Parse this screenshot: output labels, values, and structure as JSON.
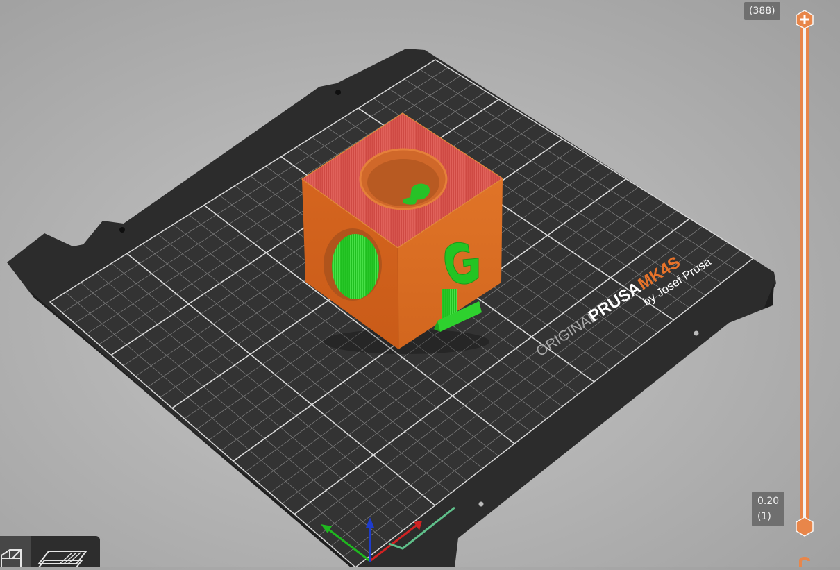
{
  "bed": {
    "brand_prefix": "ORIGINAL",
    "brand_name": "PRUSA",
    "model": "MK4S",
    "tagline": "by Josef Prusa"
  },
  "layer_slider": {
    "top_value": "(388)",
    "bottom_height": "0.20",
    "bottom_layer": "(1)"
  },
  "colors": {
    "accent": "#e8864a",
    "bed": "#2b2b2b",
    "model_orange": "#d9661f",
    "top_red": "#d94b45",
    "support_green": "#22cc22"
  },
  "icons": {
    "top_thumb": "plus-icon",
    "bottom_thumb": "hexagon-icon",
    "view_3d": "cube-icon",
    "view_layer": "layer-plane-icon"
  }
}
